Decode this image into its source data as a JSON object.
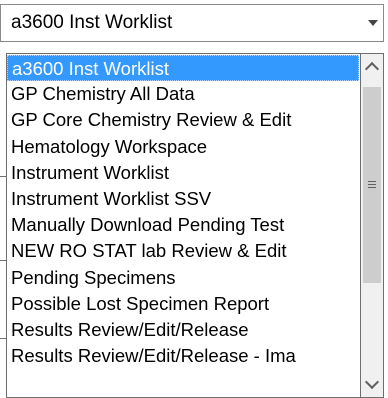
{
  "combo": {
    "selected_value": "a3600 Inst Worklist",
    "button_icon": "triangle-down-icon"
  },
  "dropdown": {
    "items": [
      {
        "label": "a3600 Inst Worklist",
        "selected": true
      },
      {
        "label": "GP Chemistry All Data",
        "selected": false
      },
      {
        "label": "GP Core Chemistry Review & Edit",
        "selected": false
      },
      {
        "label": "Hematology Workspace",
        "selected": false
      },
      {
        "label": "Instrument Worklist",
        "selected": false
      },
      {
        "label": "Instrument Worklist SSV",
        "selected": false
      },
      {
        "label": "Manually Download Pending Test",
        "selected": false
      },
      {
        "label": "NEW RO STAT lab Review & Edit",
        "selected": false
      },
      {
        "label": "Pending Specimens",
        "selected": false
      },
      {
        "label": "Possible Lost Specimen Report",
        "selected": false
      },
      {
        "label": "Results Review/Edit/Release",
        "selected": false
      },
      {
        "label": "Results Review/Edit/Release - Ima",
        "selected": false
      }
    ]
  },
  "scrollbar": {
    "up_icon": "chevron-up-icon",
    "down_icon": "chevron-down-icon",
    "thumb_icon": "grip-icon"
  },
  "colors": {
    "selection": "#3399ff",
    "border": "#6e6e6e",
    "scrollbar_track": "#f0f0f0",
    "scrollbar_thumb": "#cdcdcd"
  }
}
